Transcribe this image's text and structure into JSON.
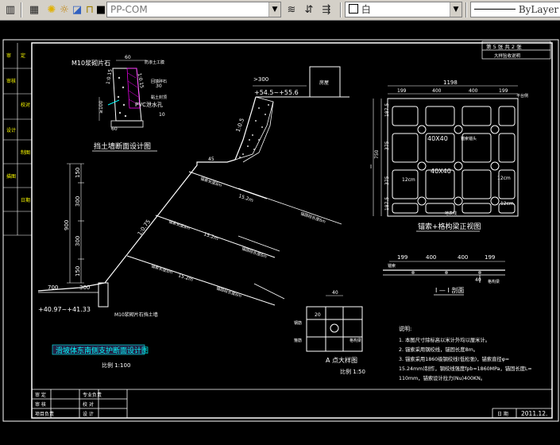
{
  "toolbar": {
    "layer_name": "PP-COM",
    "color_value": "白",
    "linetype_value": "ByLayer"
  },
  "drawing": {
    "titles": {
      "retaining_wall": "挡土墙断面设计图",
      "main_section": "滑坡体东南侧支护断面设计图",
      "main_scale": "比例 1:100",
      "grid_front": "锚索+格构梁正视图",
      "section_1": "I — I 剖面",
      "detail_a": "A 点大样图",
      "detail_a_scale": "比例 1:50",
      "header_box": "第 5 张  共 2 张",
      "header_sub": "大样验收说明"
    },
    "wall_labels": {
      "m10": "M10浆砌片石",
      "dim_60a": "60",
      "dim_60b": "60",
      "dim_ge100": "≥100",
      "pvc": "PVC泄水孔",
      "note1": "防渗土工膜",
      "note2": "回填碎石",
      "note3": "黏土封顶",
      "ratio1": "1:0.15",
      "ratio2": "1:0.15",
      "dim_10": "10",
      "dim_30": "30"
    },
    "slope_labels": {
      "dim_300": ">300",
      "elev_top": "+54.5~+55.6",
      "house": "房屋",
      "slope1": "1:0.5",
      "dim_45": "45",
      "slope2": "1:0.75",
      "anchor1": "锚索长度8m",
      "anchor2": "锚索长度8m",
      "anchor3": "锚索长度8m",
      "len1": "15.2m",
      "len2": "15.2m",
      "len3": "15.2m",
      "free1": "锚固段长度6m",
      "free2": "锚固段长度6m",
      "free3": "锚固段长度6m",
      "dim_150a": "150",
      "dim_300a": "300",
      "dim_900": "900",
      "dim_300b": "300",
      "dim_150b": "150",
      "dim_700": "700",
      "dim_300c": "300",
      "elev_bottom": "+40.97~+41.33",
      "m10_base": "M10浆砌片石挡土墙"
    },
    "grid_labels": {
      "total": "1198",
      "col1": "199",
      "col2": "400",
      "col3": "400",
      "col4": "199",
      "row1": "187.5",
      "row2": "375",
      "row3": "375",
      "row4": "187.5",
      "total_h": "750",
      "beam1": "40X40",
      "beam2": "40X40",
      "dim_12a": "12cm",
      "dim_12b": "12cm",
      "dim_12c": "12cm",
      "anchor_head": "锚索锚头",
      "ground": "地表线",
      "flat_side": "平台侧",
      "mark_i": "I"
    },
    "section_labels": {
      "d199a": "199",
      "d400a": "400",
      "d400b": "400",
      "d199b": "199",
      "d40": "40",
      "anchor": "锚索",
      "beam": "格构梁"
    },
    "detail_labels": {
      "d40": "40",
      "d20": "20",
      "rebar1": "钢筋",
      "rebar2": "箍筋",
      "beam": "格构梁"
    },
    "notes": {
      "heading": "说明:",
      "n1": "1. 本图尺寸除标高以米计外均以厘米计。",
      "n2": "2. 锚索采用钢绞线，锚固长度8m。",
      "n3": "3. 锚索采用1860级钢绞线(低松弛)，锚索直径φ=",
      "n4": "15.24mm)制作，钢绞线强度fpb=1860MPa，锚固长度L=",
      "n5": "110mm，锚索设计拉力(Nu)400KN。"
    },
    "title_block": {
      "r1c1": "审 定",
      "r1c2": "专业负责",
      "r2c1": "审 核",
      "r2c2": "校 对",
      "r3c1": "项目负责",
      "r3c2": "设 计",
      "sheet": "日 期",
      "date": "2011.12."
    },
    "left_strip": [
      "审",
      "定",
      "审核",
      "校对",
      "设计",
      "制图",
      "描图",
      "日期"
    ]
  }
}
